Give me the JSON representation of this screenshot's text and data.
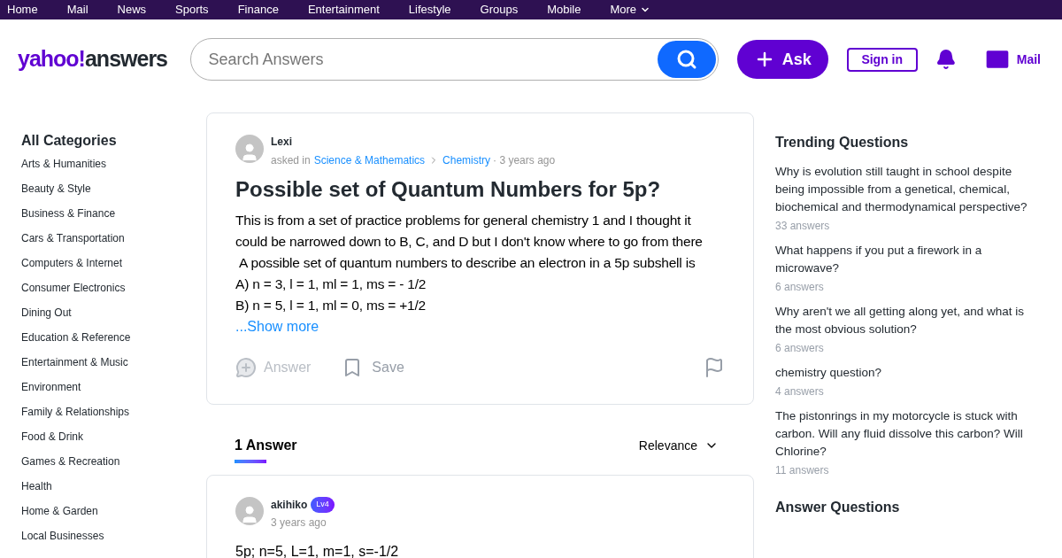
{
  "top_nav": {
    "items": [
      "Home",
      "Mail",
      "News",
      "Sports",
      "Finance",
      "Entertainment",
      "Lifestyle",
      "Groups",
      "Mobile",
      "More"
    ]
  },
  "header": {
    "logo": {
      "brand": "yahoo!",
      "product": "answers"
    },
    "search": {
      "placeholder": "Search Answers"
    },
    "ask_button": "Ask",
    "sign_in": "Sign in",
    "mail": "Mail"
  },
  "sidebar": {
    "title": "All Categories",
    "items": [
      "Arts & Humanities",
      "Beauty & Style",
      "Business & Finance",
      "Cars & Transportation",
      "Computers & Internet",
      "Consumer Electronics",
      "Dining Out",
      "Education & Reference",
      "Entertainment & Music",
      "Environment",
      "Family & Relationships",
      "Food & Drink",
      "Games & Recreation",
      "Health",
      "Home & Garden",
      "Local Businesses"
    ]
  },
  "question": {
    "author": "Lexi",
    "asked_in": "asked in",
    "category": "Science & Mathematics",
    "subcategory": "Chemistry",
    "time": "· 3 years ago",
    "title": "Possible set of Quantum Numbers for 5p?",
    "body": [
      "This is from a set of practice problems for general chemistry 1 and I thought it could be narrowed down to B, C, and D but I don't know where to go from there",
      " A possible set of quantum numbers to describe an electron in a 5p subshell is",
      "A) n = 3, l = 1, ml = 1, ms = - 1/2",
      "B) n = 5, l = 1, ml = 0, ms = +1/2"
    ],
    "show_more": "...Show more",
    "answer_button": {
      "label": "Answer",
      "disabled": true
    },
    "save_button": "Save"
  },
  "answers_header": {
    "count": "1 Answer",
    "sort": "Relevance"
  },
  "answers": [
    {
      "author": "akihiko",
      "level": "Lv4",
      "time": "3 years ago",
      "text": "5p; n=5, L=1, m=1, s=-1/2"
    }
  ],
  "trending": {
    "title": "Trending Questions",
    "items": [
      {
        "question": "Why is evolution still taught in school despite being impossible from a genetical, chemical, biochemical and thermodynamical perspective?",
        "answers": "33 answers"
      },
      {
        "question": "What happens if you put a firework in a microwave?",
        "answers": "6 answers"
      },
      {
        "question": "Why aren't we all getting along yet, and what is the most obvious solution?",
        "answers": "6 answers"
      },
      {
        "question": "chemistry question?",
        "answers": "4 answers"
      },
      {
        "question": "The pistonrings in my motorcycle is stuck with carbon. Will any fluid dissolve this carbon? Will Chlorine?",
        "answers": "11 answers"
      }
    ]
  },
  "answer_questions": {
    "title": "Answer Questions"
  }
}
